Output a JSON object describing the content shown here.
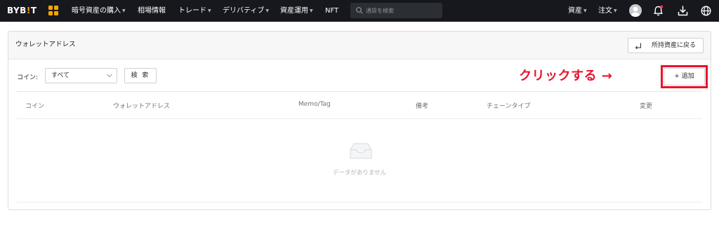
{
  "topbar": {
    "logo": "BYB!T",
    "logo_parts": [
      "BYB",
      "!",
      "T"
    ],
    "nav": [
      {
        "label": "暗号資産の購入",
        "dropdown": true
      },
      {
        "label": "相場情報",
        "dropdown": false
      },
      {
        "label": "トレード",
        "dropdown": true
      },
      {
        "label": "デリバティブ",
        "dropdown": true
      },
      {
        "label": "資産運用",
        "dropdown": true
      },
      {
        "label": "NFT",
        "dropdown": false
      }
    ],
    "search_placeholder": "通貨を検索",
    "right_menu": [
      {
        "label": "資産",
        "dropdown": true
      },
      {
        "label": "注文",
        "dropdown": true
      }
    ],
    "icons": [
      "avatar",
      "bell-icon",
      "download-icon",
      "globe-icon"
    ],
    "accent_color": "#f7a600",
    "background_color": "#17181e",
    "notification_dot_color": "#f0303f"
  },
  "page": {
    "title": "ウォレットアドレス",
    "back_button_label": "所持資産に戻る",
    "filter": {
      "coin_label": "コイン:",
      "coin_select_value": "すべて",
      "search_button_label": "検 索"
    },
    "add_button_label": "+ 追加",
    "annotation": {
      "text": "クリックする →",
      "color": "#e8132a"
    },
    "table": {
      "columns": [
        "コイン",
        "ウォレットアドレス",
        "Memo/Tag",
        "備考",
        "チェーンタイプ",
        "変更"
      ],
      "rows": [],
      "empty_text": "データがありません"
    }
  }
}
